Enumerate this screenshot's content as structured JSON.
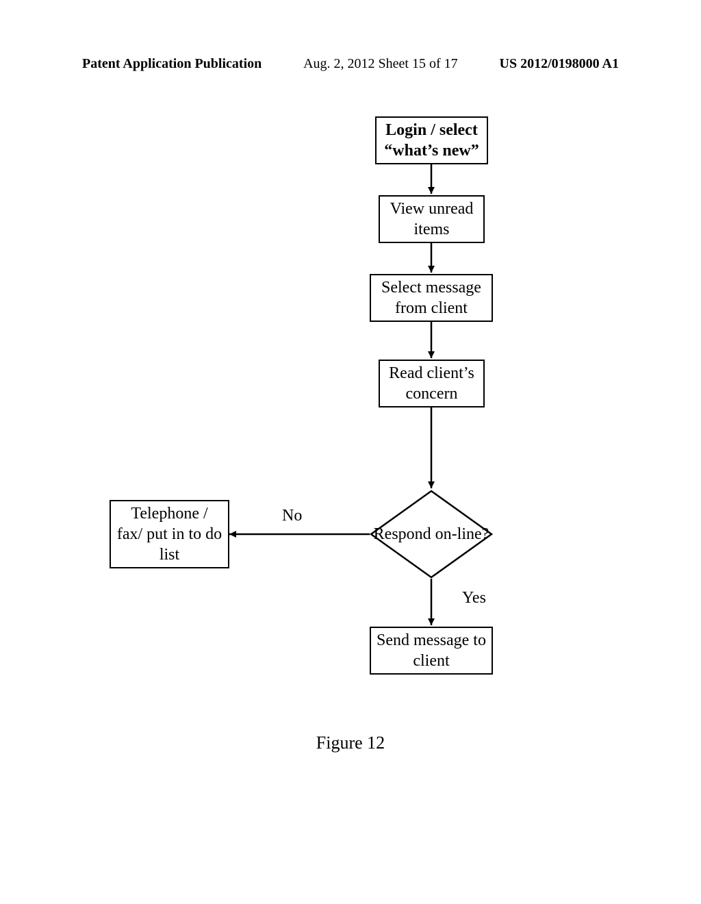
{
  "header": {
    "left": "Patent Application Publication",
    "center": "Aug. 2, 2012  Sheet 15 of 17",
    "right": "US 2012/0198000 A1"
  },
  "flow": {
    "login": "Login / select “what’s new”",
    "view_unread": "View unread items",
    "select_msg": "Select message from client",
    "read_concern": "Read client’s concern",
    "decision": "Respond on-line?",
    "no_label": "No",
    "yes_label": "Yes",
    "no_branch": "Telephone / fax/ put in to do list",
    "yes_branch": "Send message to client"
  },
  "caption": "Figure 12"
}
